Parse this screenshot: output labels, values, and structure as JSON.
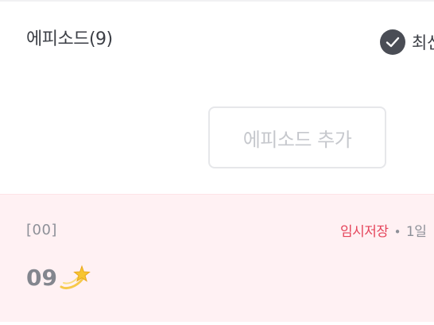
{
  "episodes_header": {
    "title": "에피소드(9)",
    "sort_label": "최신"
  },
  "add_episode": {
    "label": "에피소드 추가"
  },
  "episode_item": {
    "number": "[00]",
    "status": "임시저장",
    "separator": "•",
    "time": "1일",
    "title": "09",
    "title_icon": "dizzy-sparkle-icon"
  },
  "colors": {
    "accent_status": "#e5455b",
    "card_background": "#fff1f3",
    "check_circle": "#4a4d55"
  }
}
